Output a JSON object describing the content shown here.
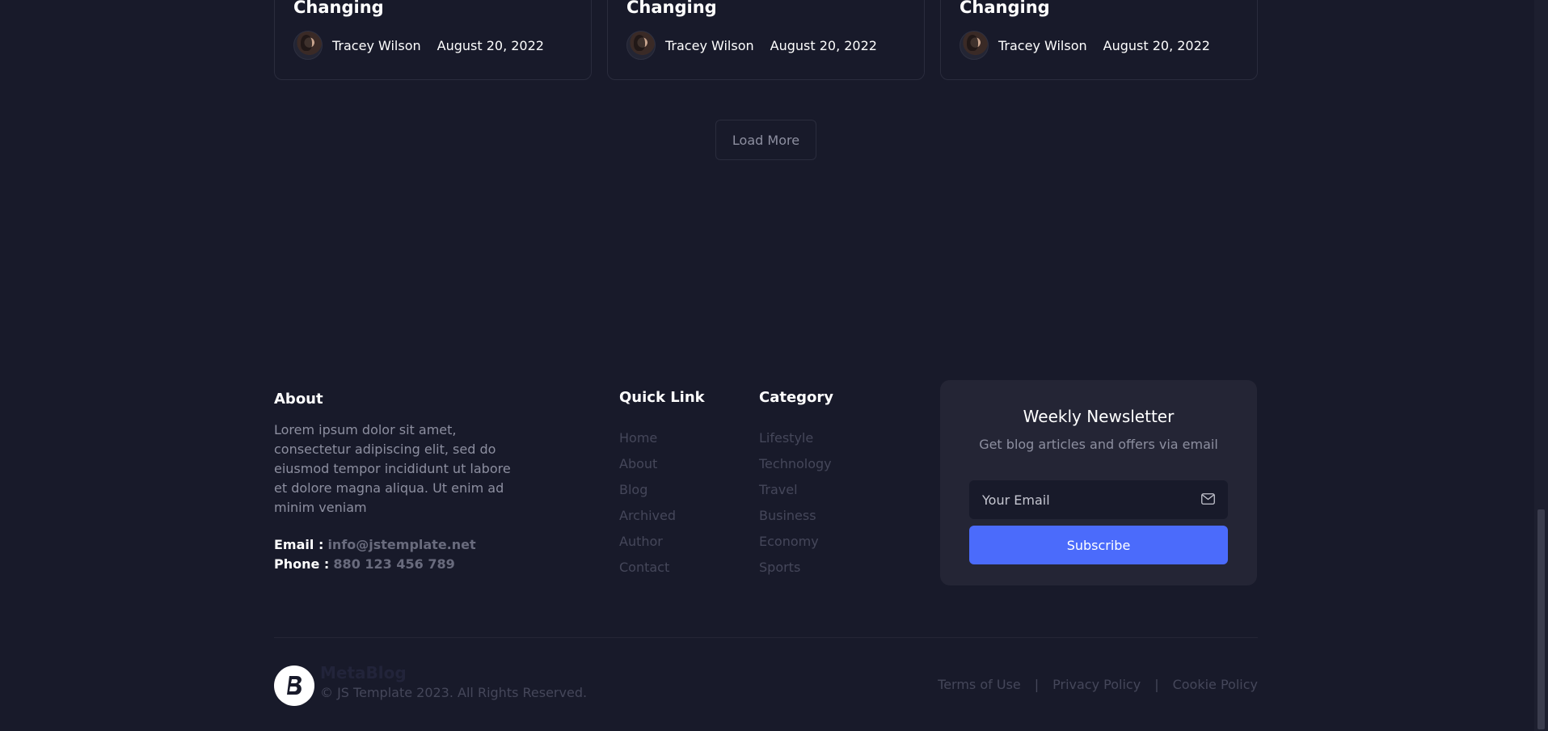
{
  "cards": [
    {
      "title": "Changing",
      "author": "Tracey Wilson",
      "date": "August 20, 2022"
    },
    {
      "title": "Changing",
      "author": "Tracey Wilson",
      "date": "August 20, 2022"
    },
    {
      "title": "Changing",
      "author": "Tracey Wilson",
      "date": "August 20, 2022"
    }
  ],
  "load_more_label": "Load More",
  "footer": {
    "about": {
      "heading": "About",
      "text": "Lorem ipsum dolor sit amet, consectetur adipiscing elit, sed do eiusmod tempor incididunt ut labore et dolore magna aliqua. Ut enim ad minim veniam",
      "email_label": "Email :",
      "email": "info@jstemplate.net",
      "phone_label": "Phone :",
      "phone": "880 123 456 789"
    },
    "quick_link": {
      "heading": "Quick Link",
      "items": [
        "Home",
        "About",
        "Blog",
        "Archived",
        "Author",
        "Contact"
      ]
    },
    "category": {
      "heading": "Category",
      "items": [
        "Lifestyle",
        "Technology",
        "Travel",
        "Business",
        "Economy",
        "Sports"
      ]
    },
    "newsletter": {
      "title": "Weekly Newsletter",
      "subtitle": "Get blog articles and offers via email",
      "email_placeholder": "Your Email",
      "button_label": "Subscribe"
    },
    "brand": {
      "name": "MetaBlog",
      "copyright": "© JS Template 2023. All Rights Reserved."
    },
    "legal": {
      "terms": "Terms of Use",
      "privacy": "Privacy Policy",
      "cookie": "Cookie Policy",
      "separator": "|"
    }
  },
  "colors": {
    "background": "#181a2a",
    "panel": "#242535",
    "accent": "#4b6bfb"
  }
}
